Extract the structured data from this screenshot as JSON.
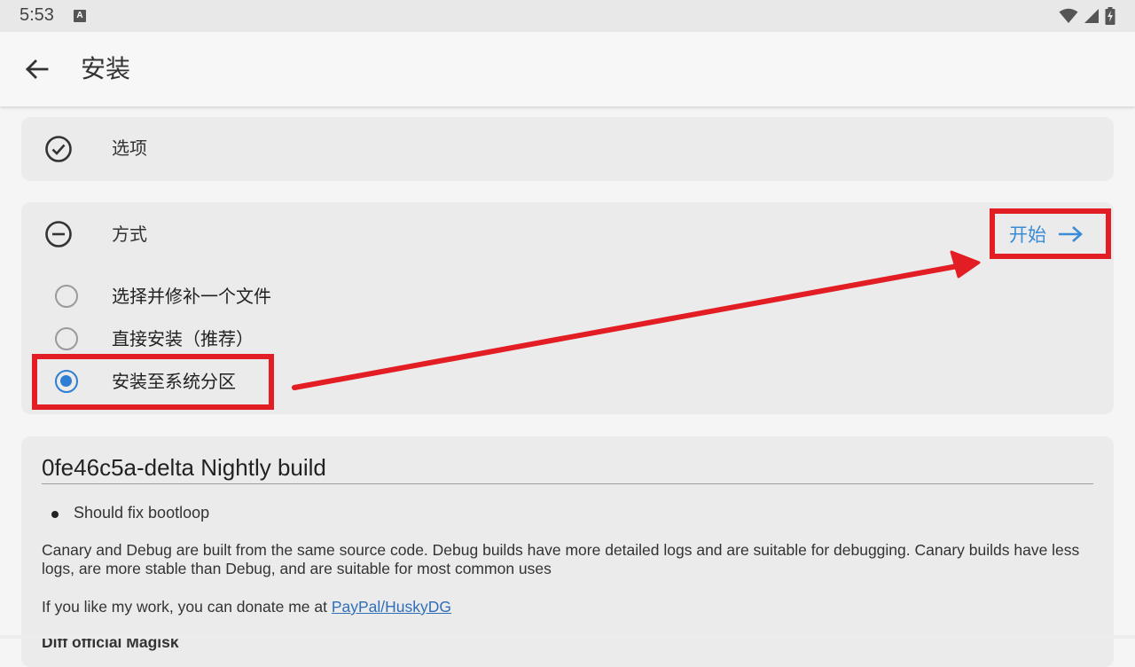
{
  "status_bar": {
    "time": "5:53",
    "notification_icon_letter": "A",
    "icons": [
      "wifi-icon",
      "signal-icon",
      "battery-charging-icon"
    ]
  },
  "app_bar": {
    "title": "安装",
    "back_icon": "back-arrow-icon"
  },
  "options_card": {
    "label": "选项",
    "icon": "check-circle-icon"
  },
  "method_card": {
    "label": "方式",
    "icon": "minus-circle-icon",
    "start_label": "开始",
    "start_icon": "arrow-right-icon",
    "choices": [
      {
        "label": "选择并修补一个文件",
        "selected": false
      },
      {
        "label": "直接安装（推荐）",
        "selected": false
      },
      {
        "label": "安装至系统分区",
        "selected": true
      }
    ]
  },
  "release_notes": {
    "title": "0fe46c5a-delta Nightly build",
    "bullets": [
      "Should fix bootloop"
    ],
    "paragraph1": "Canary and Debug are built from the same source code.  Debug builds have more detailed logs and are suitable for debugging. Canary builds have less logs, are more stable than Debug, and are suitable for most common uses",
    "donate_prefix": "If you like my work, you can donate me at ",
    "donate_link": "PayPal/HuskyDG",
    "partial_heading": "Diff    official Magisk"
  },
  "colors": {
    "accent_blue": "#2f7ed3",
    "highlight_red": "#e31d24",
    "card_bg": "#ebebeb"
  }
}
